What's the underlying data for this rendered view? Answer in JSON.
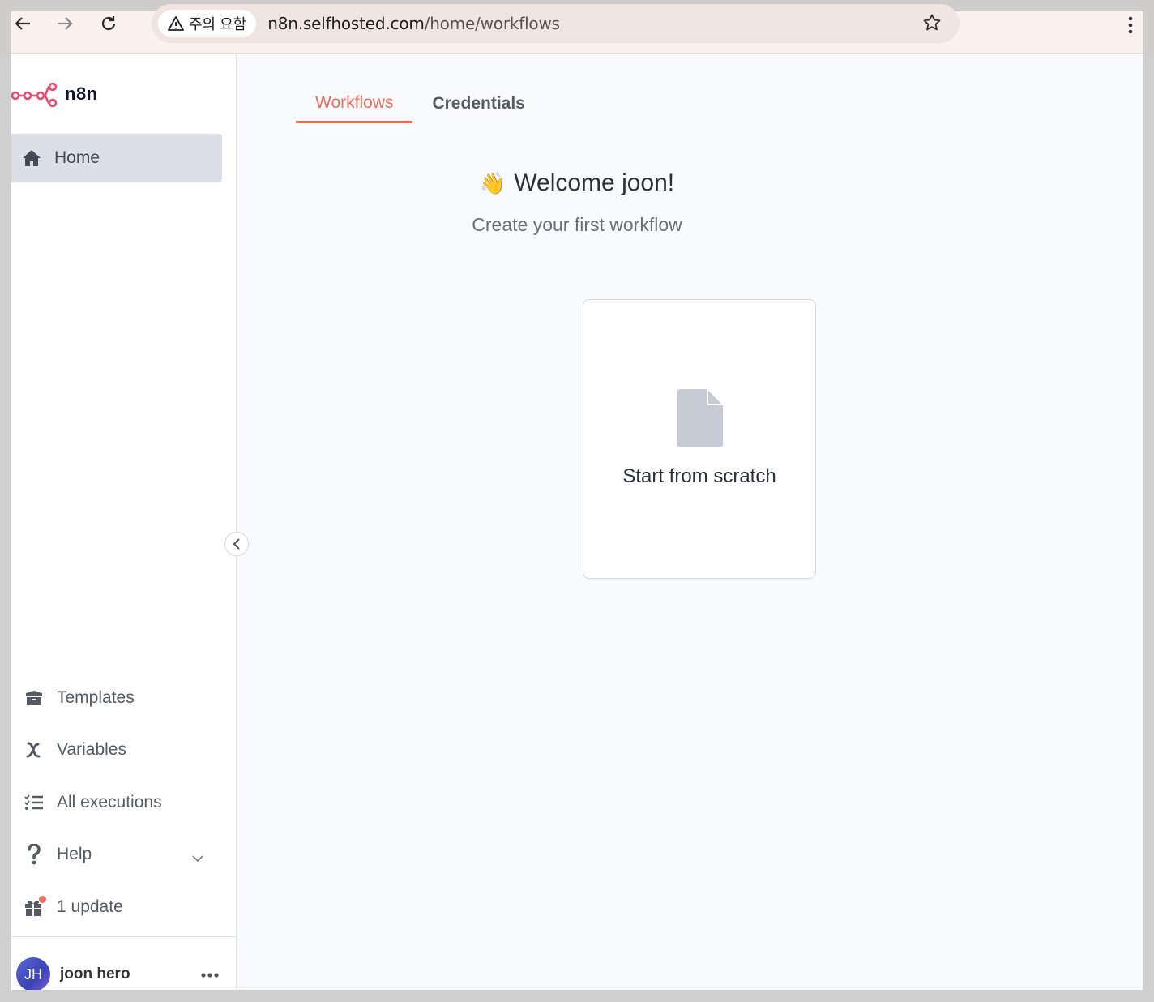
{
  "browser": {
    "security_label": "주의 요함",
    "url_host": "n8n.selfhosted.com",
    "url_path": "/home/workflows",
    "back_icon": "back-arrow-icon",
    "forward_icon": "forward-arrow-icon",
    "reload_icon": "reload-icon",
    "bookmark_icon": "star-icon",
    "menu_icon": "kebab-menu-icon"
  },
  "brand": {
    "name": "n8n",
    "accent": "#ea4b71"
  },
  "sidebar": {
    "home": "Home",
    "bottom_items": [
      {
        "label": "Templates",
        "icon": "box-icon"
      },
      {
        "label": "Variables",
        "icon": "variable-icon"
      },
      {
        "label": "All executions",
        "icon": "tasks-list-icon"
      },
      {
        "label": "Help",
        "icon": "question-icon"
      },
      {
        "label": "1 update",
        "icon": "gift-icon"
      }
    ],
    "user": {
      "initials": "JH",
      "name": "joon hero"
    }
  },
  "main": {
    "tabs": [
      {
        "label": "Workflows",
        "active": true
      },
      {
        "label": "Credentials",
        "active": false
      }
    ],
    "welcome": "Welcome joon!",
    "welcome_emoji": "👋",
    "subtitle": "Create your first workflow",
    "card_label": "Start from scratch"
  },
  "colors": {
    "tab_active": "#ea6f5d",
    "nav_active_bg": "#dcdfe8",
    "notification_dot": "#ea6f5d"
  }
}
